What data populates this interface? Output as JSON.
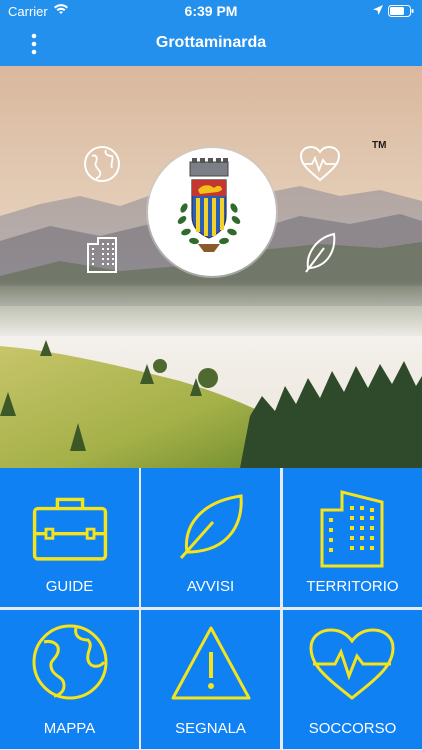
{
  "status_bar": {
    "carrier": "Carrier",
    "time": "6:39 PM"
  },
  "navbar": {
    "title": "Grottaminarda"
  },
  "hero": {
    "trademark": "TM"
  },
  "tiles": [
    {
      "label": "GUIDE",
      "icon": "briefcase-icon"
    },
    {
      "label": "AVVISI",
      "icon": "leaf-icon"
    },
    {
      "label": "TERRITORIO",
      "icon": "building-icon"
    },
    {
      "label": "MAPPA",
      "icon": "globe-icon"
    },
    {
      "label": "SEGNALA",
      "icon": "warning-icon"
    },
    {
      "label": "SOCCORSO",
      "icon": "heart-pulse-icon"
    }
  ],
  "colors": {
    "bar_blue": "#2390ee",
    "tile_blue": "#0f81f2",
    "icon_yellow": "#f5e31b"
  }
}
